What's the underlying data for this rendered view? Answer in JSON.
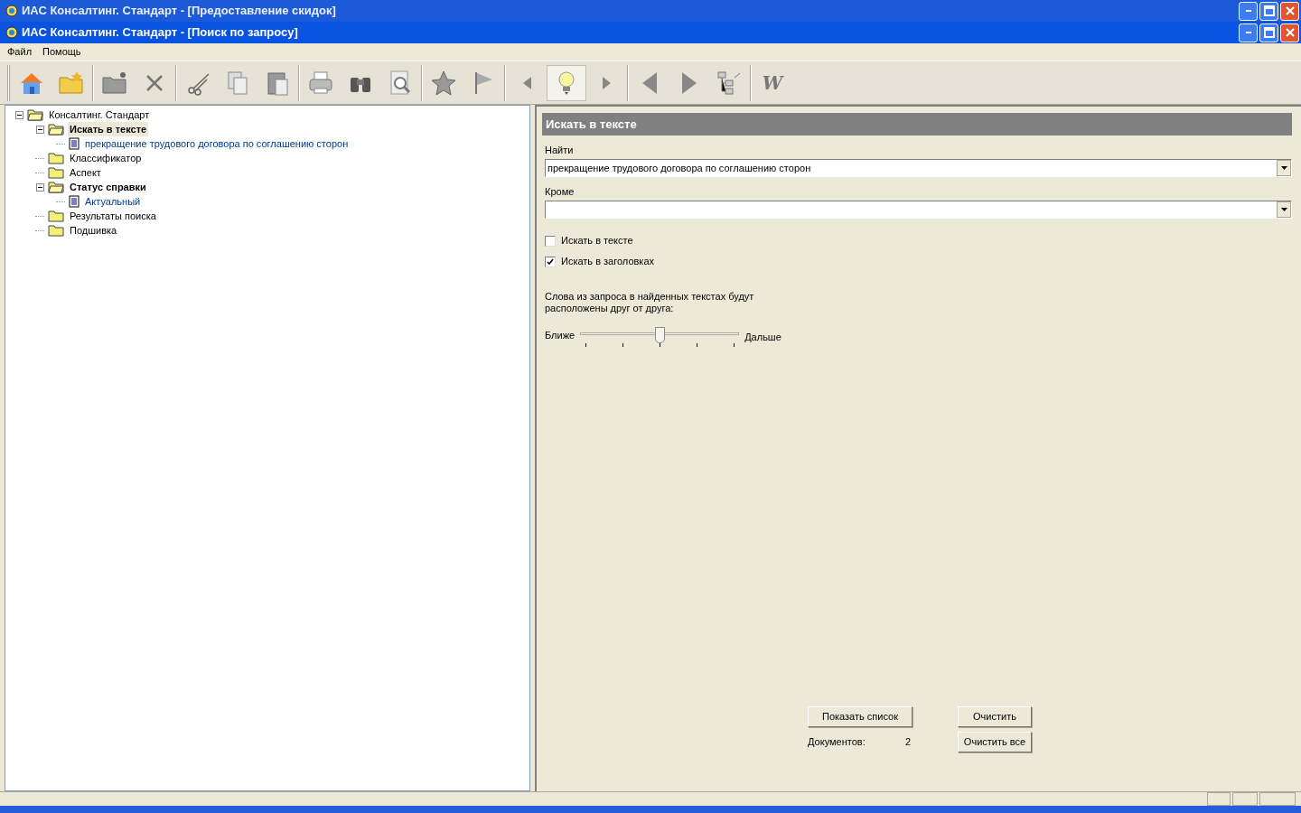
{
  "windows": [
    {
      "title": "ИАС Консалтинг. Стандарт - [Предоставление скидок]",
      "active": false
    },
    {
      "title": "ИАС Консалтинг. Стандарт - [Поиск по запросу]",
      "active": true
    }
  ],
  "menu": [
    "Файл",
    "Помощь"
  ],
  "toolbar": [
    {
      "selected": false
    },
    {
      "selected": false
    },
    {
      "selected": false
    },
    {
      "selected": false
    },
    {
      "selected": false
    },
    {
      "selected": false
    },
    {
      "selected": false
    },
    {
      "selected": false
    },
    {
      "selected": false
    },
    {
      "selected": false
    },
    {
      "selected": false
    },
    {
      "selected": false
    },
    {
      "selected": false
    },
    {
      "selected": true
    },
    {
      "selected": false
    },
    {
      "selected": false
    },
    {
      "selected": false
    },
    {
      "selected": false
    },
    {
      "selected": false,
      "label": "W"
    }
  ],
  "tree": [
    {
      "label": "Консалтинг. Стандарт",
      "kind": "folder",
      "expanded": true,
      "selected": false,
      "emphasized": false,
      "children": [
        {
          "label": "Искать в тексте",
          "kind": "folder",
          "expanded": true,
          "selected": true,
          "emphasized": true,
          "children": [
            {
              "label": "прекращение трудового договора по соглашению сторон",
              "kind": "document",
              "selected": false,
              "emphasized": false
            }
          ]
        },
        {
          "label": "Классификатор",
          "kind": "folder",
          "selected": false,
          "emphasized": false
        },
        {
          "label": "Аспект",
          "kind": "folder",
          "selected": false,
          "emphasized": false
        },
        {
          "label": "Статус справки",
          "kind": "folder",
          "expanded": true,
          "selected": false,
          "emphasized": true,
          "children": [
            {
              "label": "Актуальный",
              "kind": "document",
              "selected": false,
              "emphasized": false
            }
          ]
        },
        {
          "label": "Результаты поиска",
          "kind": "folder",
          "selected": false,
          "emphasized": false
        },
        {
          "label": "Подшивка",
          "kind": "folder",
          "selected": false,
          "emphasized": false
        }
      ]
    }
  ],
  "panel": {
    "title": "Искать в тексте",
    "find": {
      "label": "Найти",
      "value": "прекращение трудового договора по соглашению сторон"
    },
    "except": {
      "label": "Кроме"
    },
    "checkboxes": [
      {
        "label": "Искать в тексте",
        "checked": false
      },
      {
        "label": "Искать в заголовках",
        "checked": true
      }
    ],
    "proximity": {
      "caption": "Слова из запроса в найденных текстах будут расположены друг от друга:",
      "min_label": "Ближе",
      "max_label": "Дальше",
      "level": 0.5
    },
    "buttons": [
      "Показать список",
      "Очистить",
      "Очистить все"
    ],
    "count": {
      "label": "Документов:",
      "value": "2"
    }
  }
}
